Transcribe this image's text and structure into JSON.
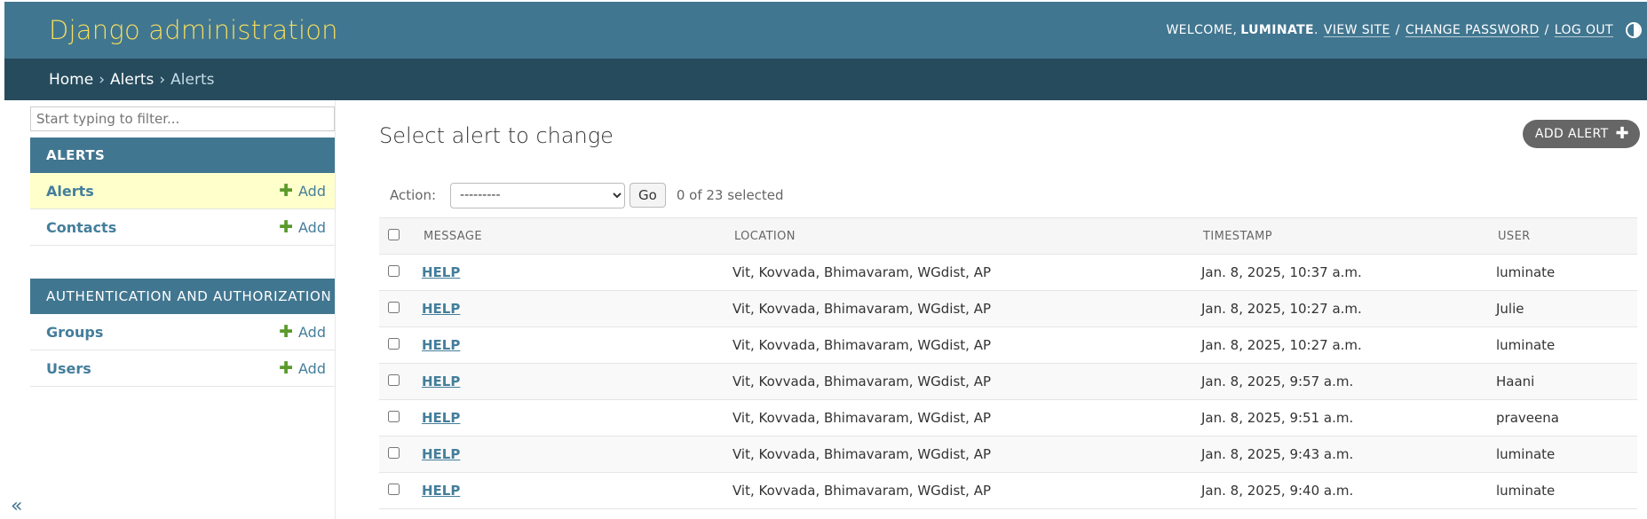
{
  "header": {
    "branding": "Django administration",
    "welcome": "WELCOME,",
    "username": "LUMINATE",
    "links": {
      "view_site": "VIEW SITE",
      "change_password": "CHANGE PASSWORD",
      "log_out": "LOG OUT"
    },
    "separator": "/"
  },
  "breadcrumbs": {
    "home": "Home",
    "app": "Alerts",
    "current": "Alerts",
    "arrow": "›"
  },
  "sidebar": {
    "filter_placeholder": "Start typing to filter...",
    "modules": [
      {
        "caption": "ALERTS",
        "items": [
          {
            "label": "Alerts",
            "add": "Add"
          },
          {
            "label": "Contacts",
            "add": "Add"
          }
        ]
      },
      {
        "caption": "AUTHENTICATION AND AUTHORIZATION",
        "items": [
          {
            "label": "Groups",
            "add": "Add"
          },
          {
            "label": "Users",
            "add": "Add"
          }
        ]
      }
    ],
    "collapse_glyph": "«"
  },
  "content": {
    "title": "Select alert to change",
    "add_button": "ADD ALERT",
    "actions": {
      "label": "Action:",
      "selected_option": "---------",
      "go": "Go",
      "counter": "0 of 23 selected"
    },
    "table": {
      "headers": [
        "MESSAGE",
        "LOCATION",
        "TIMESTAMP",
        "USER"
      ],
      "rows": [
        {
          "message": "HELP",
          "location": "Vit, Kovvada, Bhimavaram, WGdist, AP",
          "timestamp": "Jan. 8, 2025, 10:37 a.m.",
          "user": "luminate"
        },
        {
          "message": "HELP",
          "location": "Vit, Kovvada, Bhimavaram, WGdist, AP",
          "timestamp": "Jan. 8, 2025, 10:27 a.m.",
          "user": "Julie"
        },
        {
          "message": "HELP",
          "location": "Vit, Kovvada, Bhimavaram, WGdist, AP",
          "timestamp": "Jan. 8, 2025, 10:27 a.m.",
          "user": "luminate"
        },
        {
          "message": "HELP",
          "location": "Vit, Kovvada, Bhimavaram, WGdist, AP",
          "timestamp": "Jan. 8, 2025, 9:57 a.m.",
          "user": "Haani"
        },
        {
          "message": "HELP",
          "location": "Vit, Kovvada, Bhimavaram, WGdist, AP",
          "timestamp": "Jan. 8, 2025, 9:51 a.m.",
          "user": "praveena"
        },
        {
          "message": "HELP",
          "location": "Vit, Kovvada, Bhimavaram, WGdist, AP",
          "timestamp": "Jan. 8, 2025, 9:43 a.m.",
          "user": "luminate"
        },
        {
          "message": "HELP",
          "location": "Vit, Kovvada, Bhimavaram, WGdist, AP",
          "timestamp": "Jan. 8, 2025, 9:40 a.m.",
          "user": "luminate"
        }
      ]
    }
  },
  "colors": {
    "header_bg": "#417690",
    "breadcrumbs_bg": "#264b5d",
    "branding_text": "#f5dd5d",
    "link": "#447e9b",
    "add_plus": "#5b9a2b",
    "selected_row": "#ffffcc"
  },
  "icons": {
    "theme_toggle": "half-circle-icon",
    "add": "plus-icon",
    "collapse": "double-chevron-left-icon"
  }
}
